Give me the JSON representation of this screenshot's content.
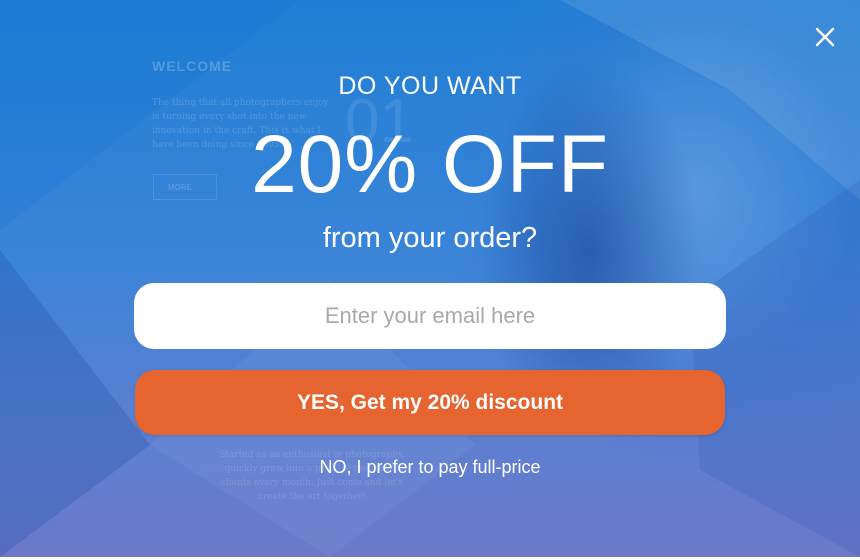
{
  "background": {
    "welcome": "WELCOME",
    "intro_text": "The thing that all photographers enjoy is turning every shot into the new innovation in the craft. This is what I have been doing since 1995.",
    "number": "01",
    "more_label": "MORE",
    "story_text": "Started as an enthusiast in photography, quickly grew into a pro... of respectful clients every month. Just come and let's create the art together!"
  },
  "popup": {
    "headline_line1": "DO YOU WANT",
    "headline_line2": "20% OFF",
    "headline_line3": "from your order?",
    "email_placeholder": "Enter your email here",
    "cta_label": "YES, Get my 20% discount",
    "decline_label": "NO, I prefer to pay full-price",
    "close_icon": "close-icon"
  },
  "colors": {
    "background_top": "#1f7fd4",
    "background_bottom": "#6c79c9",
    "cta": "#e5642f",
    "text": "#ffffff"
  }
}
